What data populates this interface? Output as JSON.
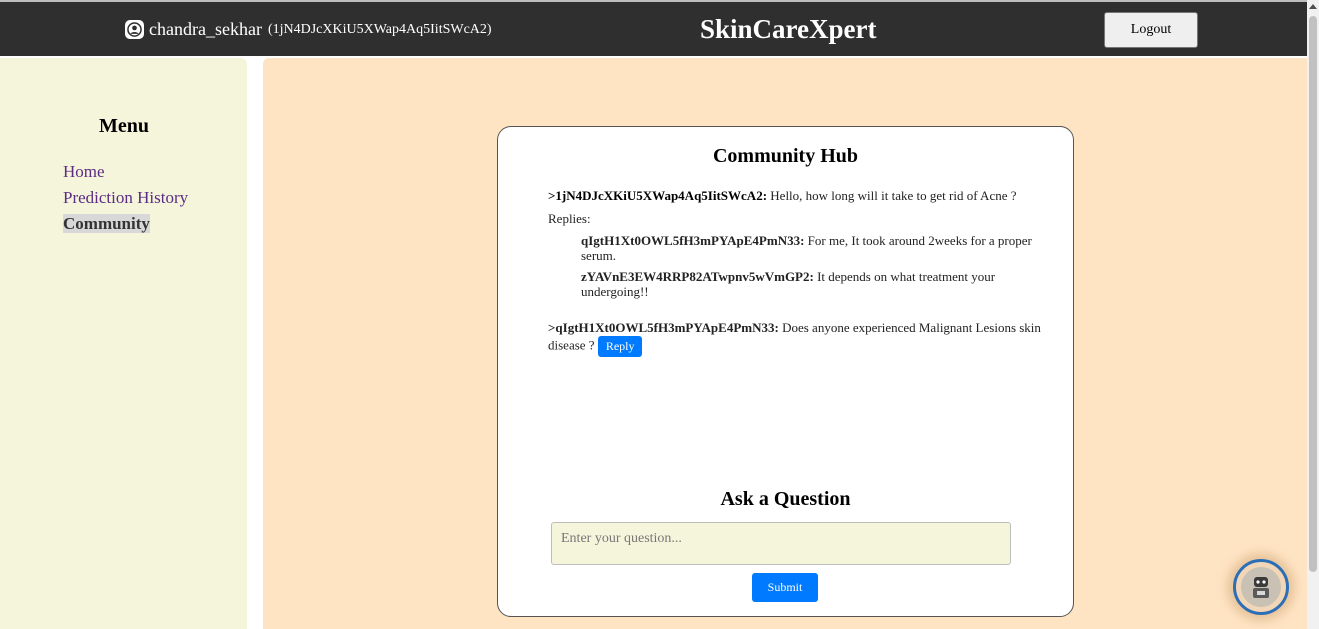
{
  "header": {
    "user_icon": "user-circle-icon",
    "username": "chandra_sekhar",
    "user_id": "(1jN4DJcXKiU5XWap4Aq5IitSWcA2)",
    "brand": "SkinCareXpert",
    "logout_label": "Logout"
  },
  "sidebar": {
    "title": "Menu",
    "items": [
      {
        "label": "Home"
      },
      {
        "label": "Prediction History"
      },
      {
        "label": "Community"
      }
    ]
  },
  "community": {
    "title": "Community Hub",
    "posts": [
      {
        "author": ">1jN4DJcXKiU5XWap4Aq5IitSWcA2:",
        "text": "Hello, how long will it take to get rid of Acne ?",
        "replies_label": "Replies:",
        "replies": [
          {
            "author": "qIgtH1Xt0OWL5fH3mPYApE4PmN33:",
            "text": "For me, It took around 2weeks for a proper serum."
          },
          {
            "author": "zYAVnE3EW4RRP82ATwpnv5wVmGP2:",
            "text": "It depends on what treatment your undergoing!!"
          }
        ]
      },
      {
        "author": ">qIgtH1Xt0OWL5fH3mPYApE4PmN33:",
        "text": "Does anyone experienced Malignant Lesions skin disease ?",
        "reply_button": "Reply"
      }
    ]
  },
  "ask": {
    "title": "Ask a Question",
    "placeholder": "Enter your question...",
    "submit_label": "Submit"
  },
  "colors": {
    "topbar": "#2f2f2f",
    "sidebar": "#f5f5dc",
    "main": "#ffe4c4",
    "accent": "#007bff",
    "nav_link": "#5b2c83"
  },
  "chatbot_icon": "chatbot-avatar-icon"
}
